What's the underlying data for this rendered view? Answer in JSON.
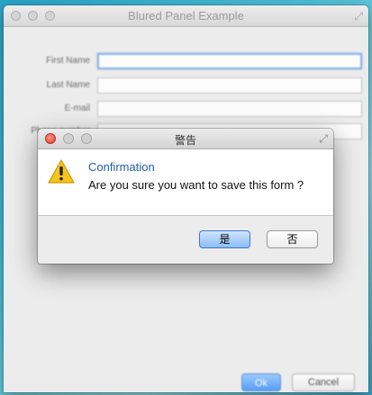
{
  "window": {
    "title": "Blured Panel Example"
  },
  "form": {
    "fields": [
      {
        "label": "First Name",
        "value": ""
      },
      {
        "label": "Last Name",
        "value": ""
      },
      {
        "label": "E-mail",
        "value": ""
      },
      {
        "label": "Phone number",
        "value": ""
      }
    ]
  },
  "buttons": {
    "ok": "Ok",
    "cancel": "Cancel"
  },
  "dialog": {
    "title": "警告",
    "heading": "Confirmation",
    "message": "Are you sure you want to save this form ?",
    "yes": "是",
    "no": "否",
    "icon": "warning-icon"
  },
  "colors": {
    "accent": "#3d8ef5",
    "heading": "#1f5fb0",
    "close": "#e0443a"
  }
}
